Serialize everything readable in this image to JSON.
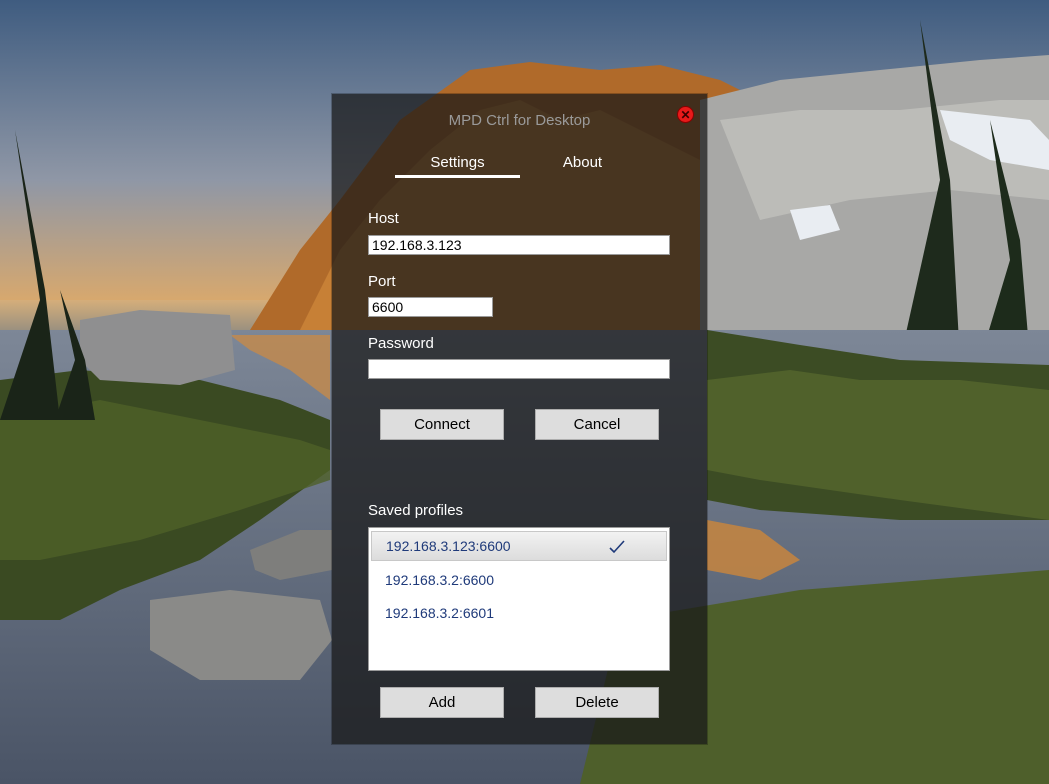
{
  "window": {
    "title": "MPD Ctrl for Desktop",
    "close_icon": "close-icon",
    "accent_close": "#e81a1a"
  },
  "tabs": [
    {
      "label": "Settings",
      "selected": true
    },
    {
      "label": "About",
      "selected": false
    }
  ],
  "form": {
    "host_label": "Host",
    "host_value": "192.168.3.123",
    "port_label": "Port",
    "port_value": "6600",
    "password_label": "Password",
    "password_value": ""
  },
  "actions": {
    "connect_label": "Connect",
    "cancel_label": "Cancel"
  },
  "profiles": {
    "label": "Saved profiles",
    "items": [
      {
        "text": "192.168.3.123:6600",
        "selected": true,
        "icon": "check-icon"
      },
      {
        "text": "192.168.3.2:6600",
        "selected": false
      },
      {
        "text": "192.168.3.2:6601",
        "selected": false
      }
    ],
    "add_label": "Add",
    "delete_label": "Delete"
  }
}
